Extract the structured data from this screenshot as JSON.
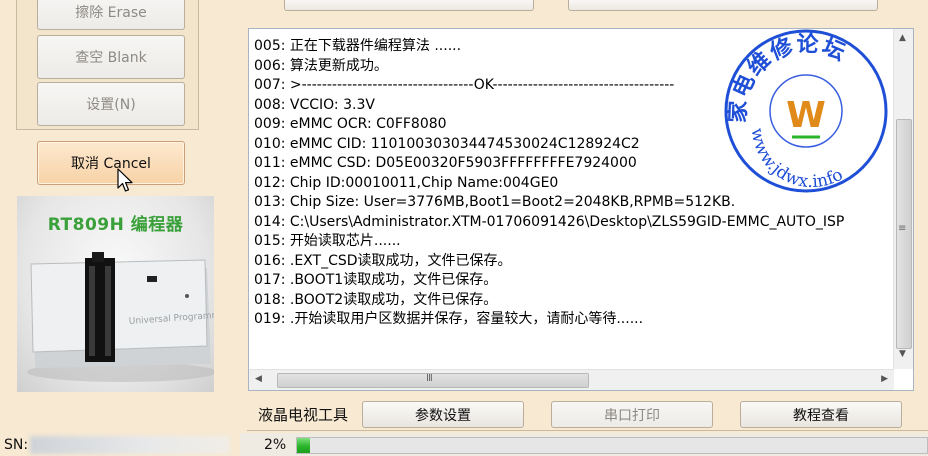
{
  "left_panel": {
    "buttons": [
      {
        "label": "擦除 Erase",
        "enabled": false
      },
      {
        "label": "查空 Blank",
        "enabled": false
      },
      {
        "label": "设置(N)",
        "enabled": false
      }
    ],
    "cancel_button": "取消 Cancel",
    "promo": {
      "title": "RT809H 编程器",
      "device_text": "Universal Programmer"
    },
    "sn_label": "SN:"
  },
  "log": {
    "lines": [
      "005: 正在下载器件编程算法 ......",
      "006: 算法更新成功。",
      "007: >----------------------------------OK------------------------------------",
      "008: VCCIO: 3.3V",
      "009: eMMC OCR: C0FF8080",
      "010: eMMC CID:  110100303034474530024C128924C2",
      "011: eMMC CSD: D05E00320F5903FFFFFFFFE7924000",
      "012: Chip ID:00010011,Chip Name:004GE0",
      "013: Chip Size: User=3776MB,Boot1=Boot2=2048KB,RPMB=512KB.",
      "014: C:\\Users\\Administrator.XTM-01706091426\\Desktop\\ZLS59GID-EMMC_AUTO_ISP",
      "015: 开始读取芯片......",
      "016: .EXT_CSD读取成功，文件已保存。",
      "017: .BOOT1读取成功，文件已保存。",
      "018: .BOOT2读取成功，文件已保存。",
      "019: .开始读取用户区数据并保存，容量较大，请耐心等待......"
    ],
    "hscroll_grip": "III",
    "vscroll_grip": "≡"
  },
  "toolbar": {
    "label": "液晶电视工具",
    "param_button": "参数设置",
    "serial_button": "串口打印",
    "tutorial_button": "教程查看"
  },
  "status": {
    "progress_text": "2%",
    "progress_value": 0.02
  },
  "watermark": {
    "top_text": "家电维修论坛",
    "url": "www.jdwx.info",
    "logo": "W"
  },
  "colors": {
    "accent_green": "#2ab52a",
    "watermark_blue": "#1f4fd6",
    "promo_title": "#3aa03a"
  }
}
